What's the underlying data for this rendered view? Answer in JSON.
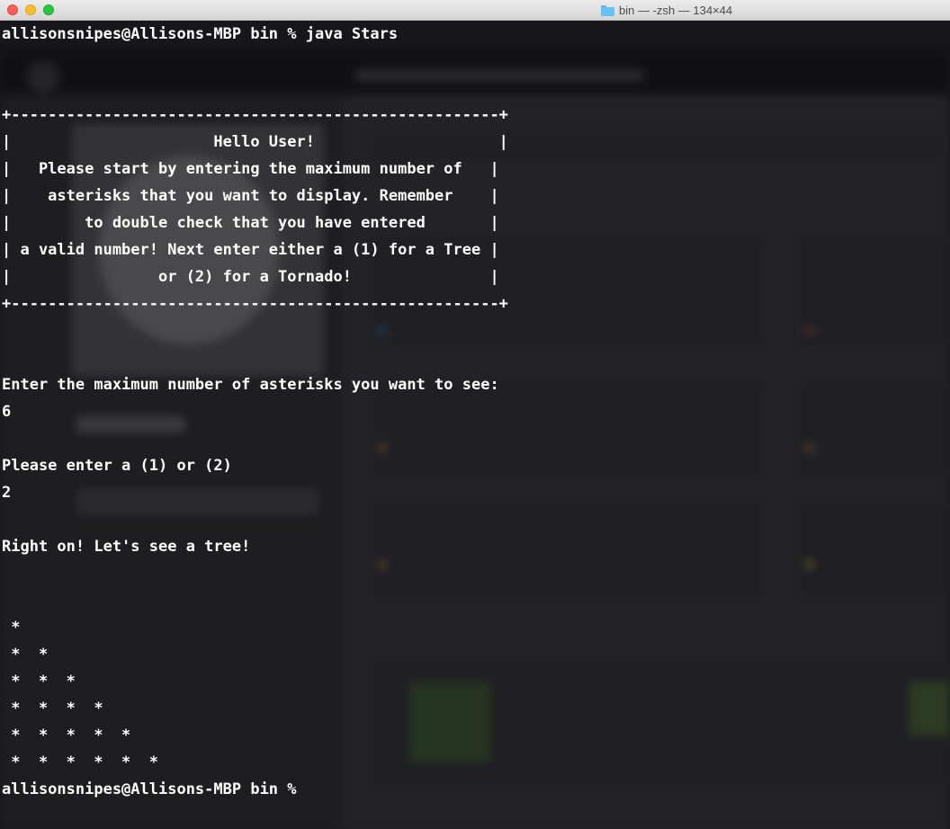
{
  "window": {
    "title": "bin — -zsh — 134×44",
    "folder_icon": "folder-icon",
    "traffic_lights": {
      "close": "#fe5f57",
      "minimize": "#febc2e",
      "zoom": "#28c840"
    }
  },
  "terminal": {
    "lines": [
      "allisonsnipes@Allisons-MBP bin % java Stars",
      "",
      "",
      "+-----------------------------------------------------+",
      "|                      Hello User!                    |",
      "|   Please start by entering the maximum number of   |",
      "|    asterisks that you want to display. Remember    |",
      "|        to double check that you have entered       |",
      "| a valid number! Next enter either a (1) for a Tree |",
      "|                or (2) for a Tornado!               |",
      "+-----------------------------------------------------+",
      "",
      "",
      "Enter the maximum number of asterisks you want to see:",
      "6",
      "",
      "Please enter a (1) or (2)",
      "2",
      "",
      "Right on! Let's see a tree!",
      "",
      "",
      " *",
      " *  *",
      " *  *  *",
      " *  *  *  *",
      " *  *  *  *  *",
      " *  *  *  *  *  *",
      "allisonsnipes@Allisons-MBP bin %"
    ]
  }
}
